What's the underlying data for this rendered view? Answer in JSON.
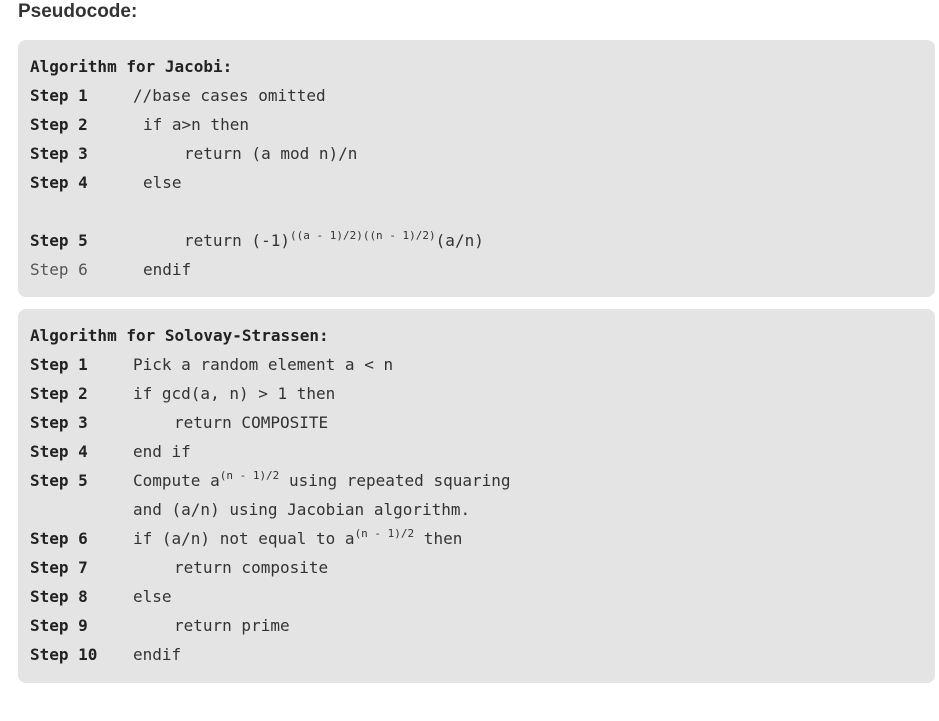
{
  "heading": "Pseudocode:",
  "jacobi": {
    "title": "Algorithm for Jacobi:",
    "steps": [
      {
        "label": "Step 1",
        "text": "//base cases omitted"
      },
      {
        "label": "Step 2",
        "text": "if a>n then"
      },
      {
        "label": "Step 3",
        "text": "return (a mod n)/n"
      },
      {
        "label": "Step 4",
        "text": "else"
      },
      {
        "label": "Step 5",
        "pre": "return (-1)",
        "sup": "((a - 1)/2)((n - 1)/2)",
        "post": "(a/n)"
      },
      {
        "label": "Step 6",
        "text": "endif"
      }
    ]
  },
  "solovay": {
    "title": "Algorithm for Solovay-Strassen:",
    "steps": [
      {
        "label": "Step 1",
        "text": "Pick a random element a < n"
      },
      {
        "label": "Step 2",
        "text": "if gcd(a, n) > 1 then"
      },
      {
        "label": "Step 3",
        "text": "return COMPOSITE"
      },
      {
        "label": "Step 4",
        "text": "end if"
      },
      {
        "label": "Step 5",
        "pre": "Compute a",
        "sup": "(n - 1)/2",
        "post": " using repeated squaring"
      },
      {
        "label": "",
        "text": "and (a/n) using Jacobian algorithm."
      },
      {
        "label": "Step 6",
        "pre": "if (a/n) not equal to a",
        "sup": "(n - 1)/2",
        "post": " then"
      },
      {
        "label": "Step 7",
        "text": "return composite"
      },
      {
        "label": "Step 8",
        "text": "else"
      },
      {
        "label": "Step 9",
        "text": "return prime"
      },
      {
        "label": "Step 10",
        "text": "endif"
      }
    ]
  }
}
